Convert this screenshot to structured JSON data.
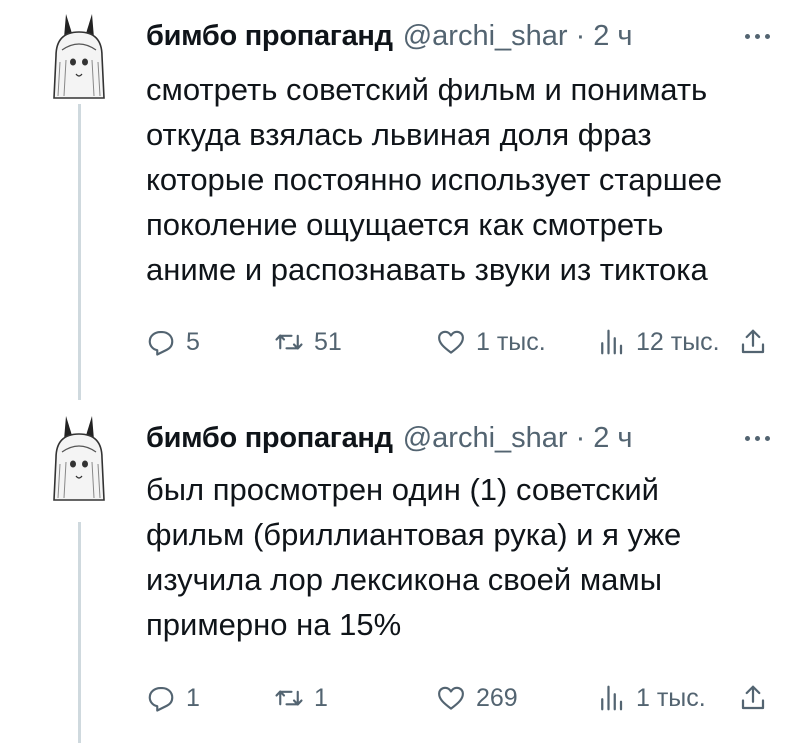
{
  "tweets": [
    {
      "author_name": "бимбо пропаганд",
      "handle": "@archi_shar",
      "separator": "·",
      "time": "2 ч",
      "text_lines": [
        "смотреть советский фильм и понимать",
        "откуда взялась львиная доля фраз",
        "которые постоянно использует старшее",
        "поколение ощущается как смотреть",
        "аниме и распознавать звуки из тиктока"
      ],
      "replies": "5",
      "retweets": "51",
      "likes": "1 тыс.",
      "views": "12 тыс."
    },
    {
      "author_name": "бимбо пропаганд",
      "handle": "@archi_shar",
      "separator": "·",
      "time": "2 ч",
      "text_lines": [
        "был просмотрен один (1) советский",
        "фильм (бриллиантовая рука) и я уже",
        "изучила лор лексикона своей мамы",
        "примерно на 15%"
      ],
      "replies": "1",
      "retweets": "1",
      "likes": "269",
      "views": "1 тыс."
    }
  ],
  "icons": {
    "reply": "reply-icon",
    "retweet": "retweet-icon",
    "like": "like-icon",
    "views": "views-icon",
    "share": "share-icon",
    "more": "more-icon"
  },
  "colors": {
    "text": "#0f1419",
    "secondary": "#536471",
    "thread_line": "#cfd9de"
  }
}
